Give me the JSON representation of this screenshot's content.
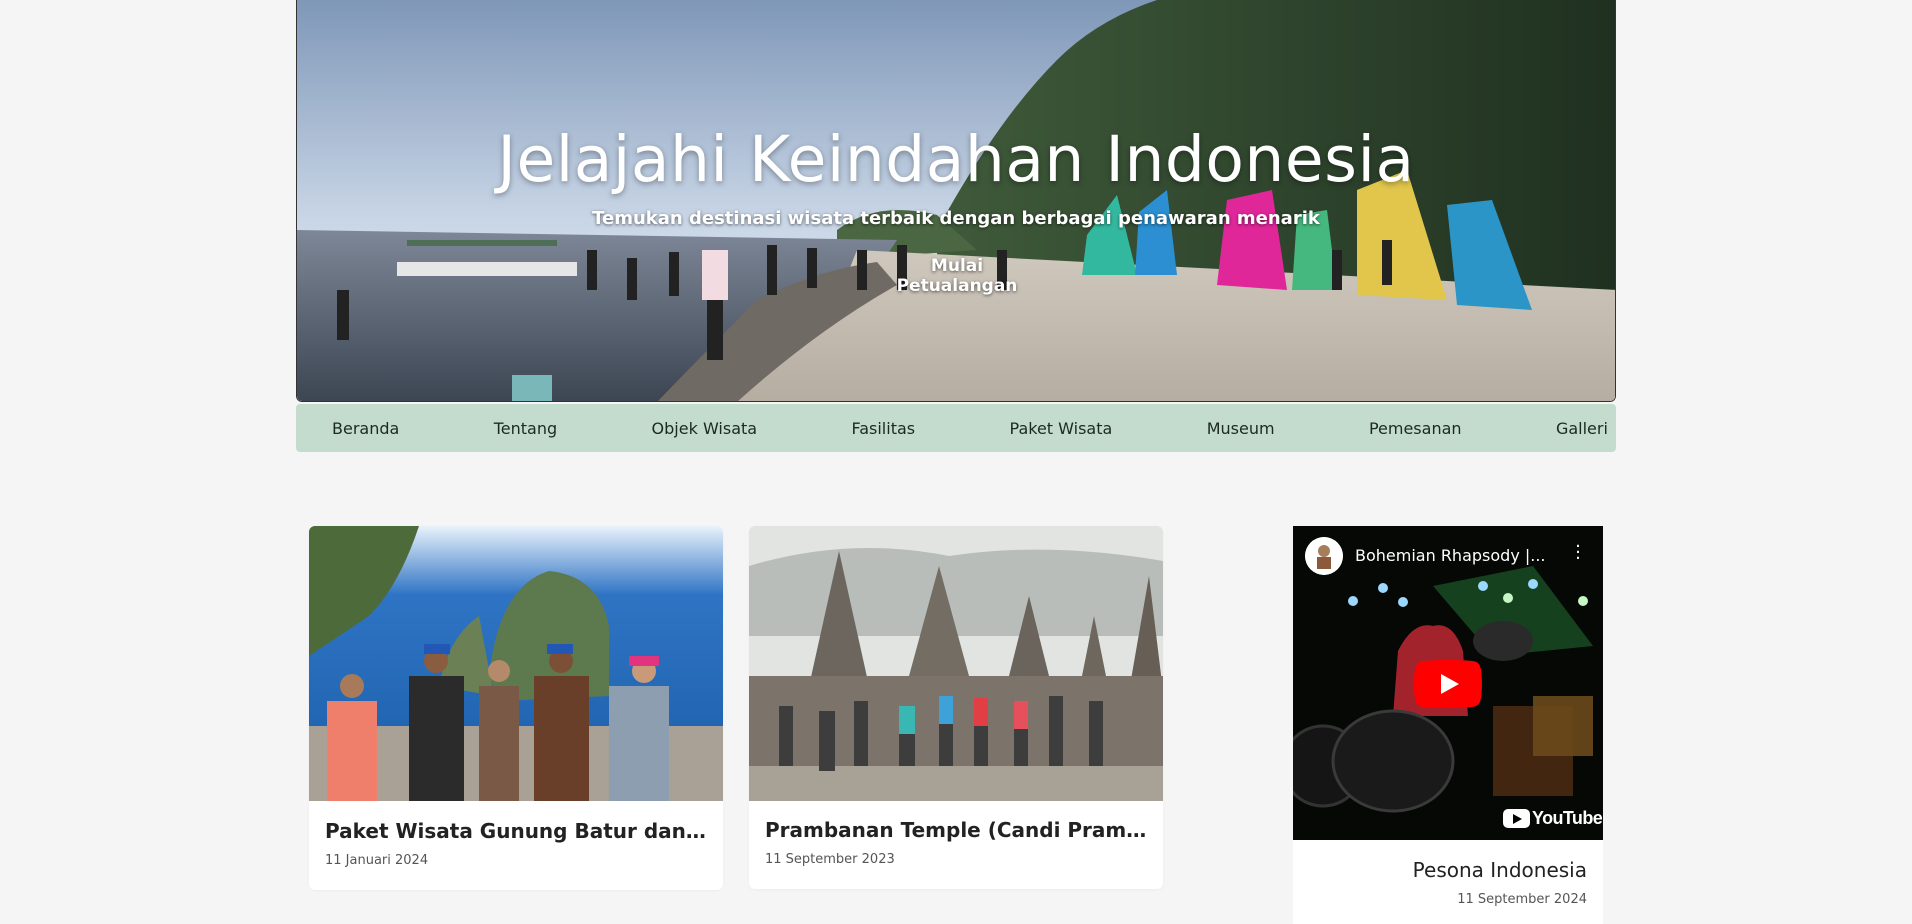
{
  "hero": {
    "title": "Jelajahi Keindahan Indonesia",
    "subtitle": "Temukan destinasi wisata terbaik dengan berbagai penawaran menarik",
    "cta_label": "Mulai Petualangan"
  },
  "nav": {
    "items": [
      {
        "label": "Beranda"
      },
      {
        "label": "Tentang"
      },
      {
        "label": "Objek Wisata"
      },
      {
        "label": "Fasilitas"
      },
      {
        "label": "Paket Wisata"
      },
      {
        "label": "Museum"
      },
      {
        "label": "Pemesanan"
      },
      {
        "label": "Galleri"
      }
    ]
  },
  "cards": [
    {
      "title": "Paket Wisata Gunung Batur dan Ayung Rafting",
      "date": "11 Januari 2024"
    },
    {
      "title": "Prambanan Temple (Candi Prambanan)",
      "date": "11 September 2023"
    }
  ],
  "video": {
    "embed_title": "Bohemian Rhapsody |...",
    "brand": "YouTube",
    "card_title": "Pesona Indonesia",
    "card_date": "11 September 2024"
  },
  "colors": {
    "page_bg": "#f5f5f5",
    "nav_bg": "#c3dccd",
    "youtube_red": "#ff0000"
  }
}
